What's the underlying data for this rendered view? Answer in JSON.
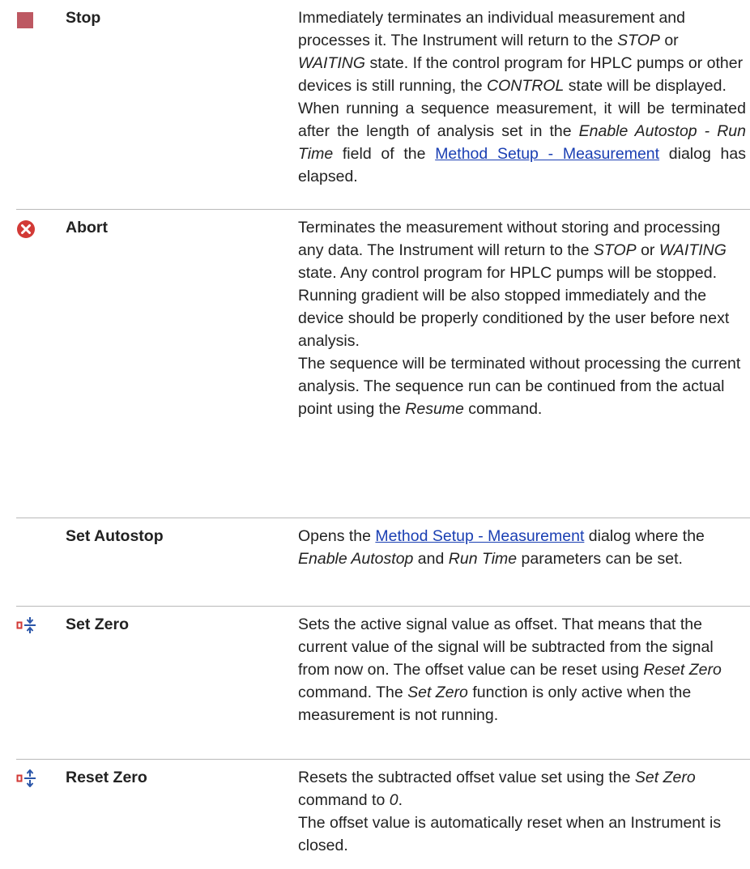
{
  "colors": {
    "text": "#222222",
    "link": "#1a3fb3",
    "divider": "#b9b9b9",
    "stop_icon": "#b23b46",
    "abort_icon": "#d23a36",
    "zero_icon_red": "#d23a36",
    "zero_icon_blue": "#2a55a8"
  },
  "rows": [
    {
      "icon": "stop-square-icon",
      "name": "Stop",
      "p1": {
        "t1": "Immediately terminates an individual measurement and processes it. The Instrument will return to the ",
        "i1": "STOP",
        "t2": " or ",
        "i2": "WAITING",
        "t3": " state. If the control program for HPLC pumps or other devices is still running, the ",
        "i3": "CONTROL",
        "t4": " state will be displayed."
      },
      "p2": {
        "t1": "When running a sequence measurement, it will be terminated after the length of analysis set in the ",
        "i1": "Enable Autostop - Run Time",
        "t2": " field of the ",
        "link": "Method Setup - Measurement",
        "t3": " dialog has elapsed."
      }
    },
    {
      "icon": "abort-x-circle-icon",
      "name": "Abort",
      "p1": {
        "t1": "Terminates the measurement without storing and processing any data. The Instrument will return to the ",
        "i1": "STOP",
        "t2": " or ",
        "i2": "WAITING",
        "t3": " state. Any control program for HPLC pumps will be stopped. Running gradient will be also stopped immediately and the device should be properly conditioned by the user before next analysis."
      },
      "p2": {
        "t1": "The sequence will be terminated without processing the current analysis. The sequence run can be continued from the actual point using the ",
        "i1": "Resume",
        "t2": " command."
      }
    },
    {
      "icon": "",
      "name": "Set Autostop",
      "p1": {
        "t1": "Opens the ",
        "link": "Method Setup - Measurement",
        "t2": " dialog where the ",
        "i1": "Enable Autostop",
        "t3": " and ",
        "i2": "Run Time",
        "t4": " parameters can be set."
      }
    },
    {
      "icon": "set-zero-icon",
      "name": "Set Zero",
      "p1": {
        "t1": "Sets the active signal value as offset. That means that the current value of the signal will be subtracted from the signal from now on. The offset value can be reset using ",
        "i1": "Reset Zero",
        "t2": " command. The ",
        "i2": "Set Zero",
        "t3": " function is only active when the measurement is not running."
      }
    },
    {
      "icon": "reset-zero-icon",
      "name": "Reset Zero",
      "p1": {
        "t1": "Resets the subtracted offset value set using the ",
        "i1": "Set Zero",
        "t2": " command to ",
        "i2": "0",
        "t3": "."
      },
      "p2": {
        "t1": "The offset value is automatically reset when an Instrument is closed."
      }
    }
  ]
}
